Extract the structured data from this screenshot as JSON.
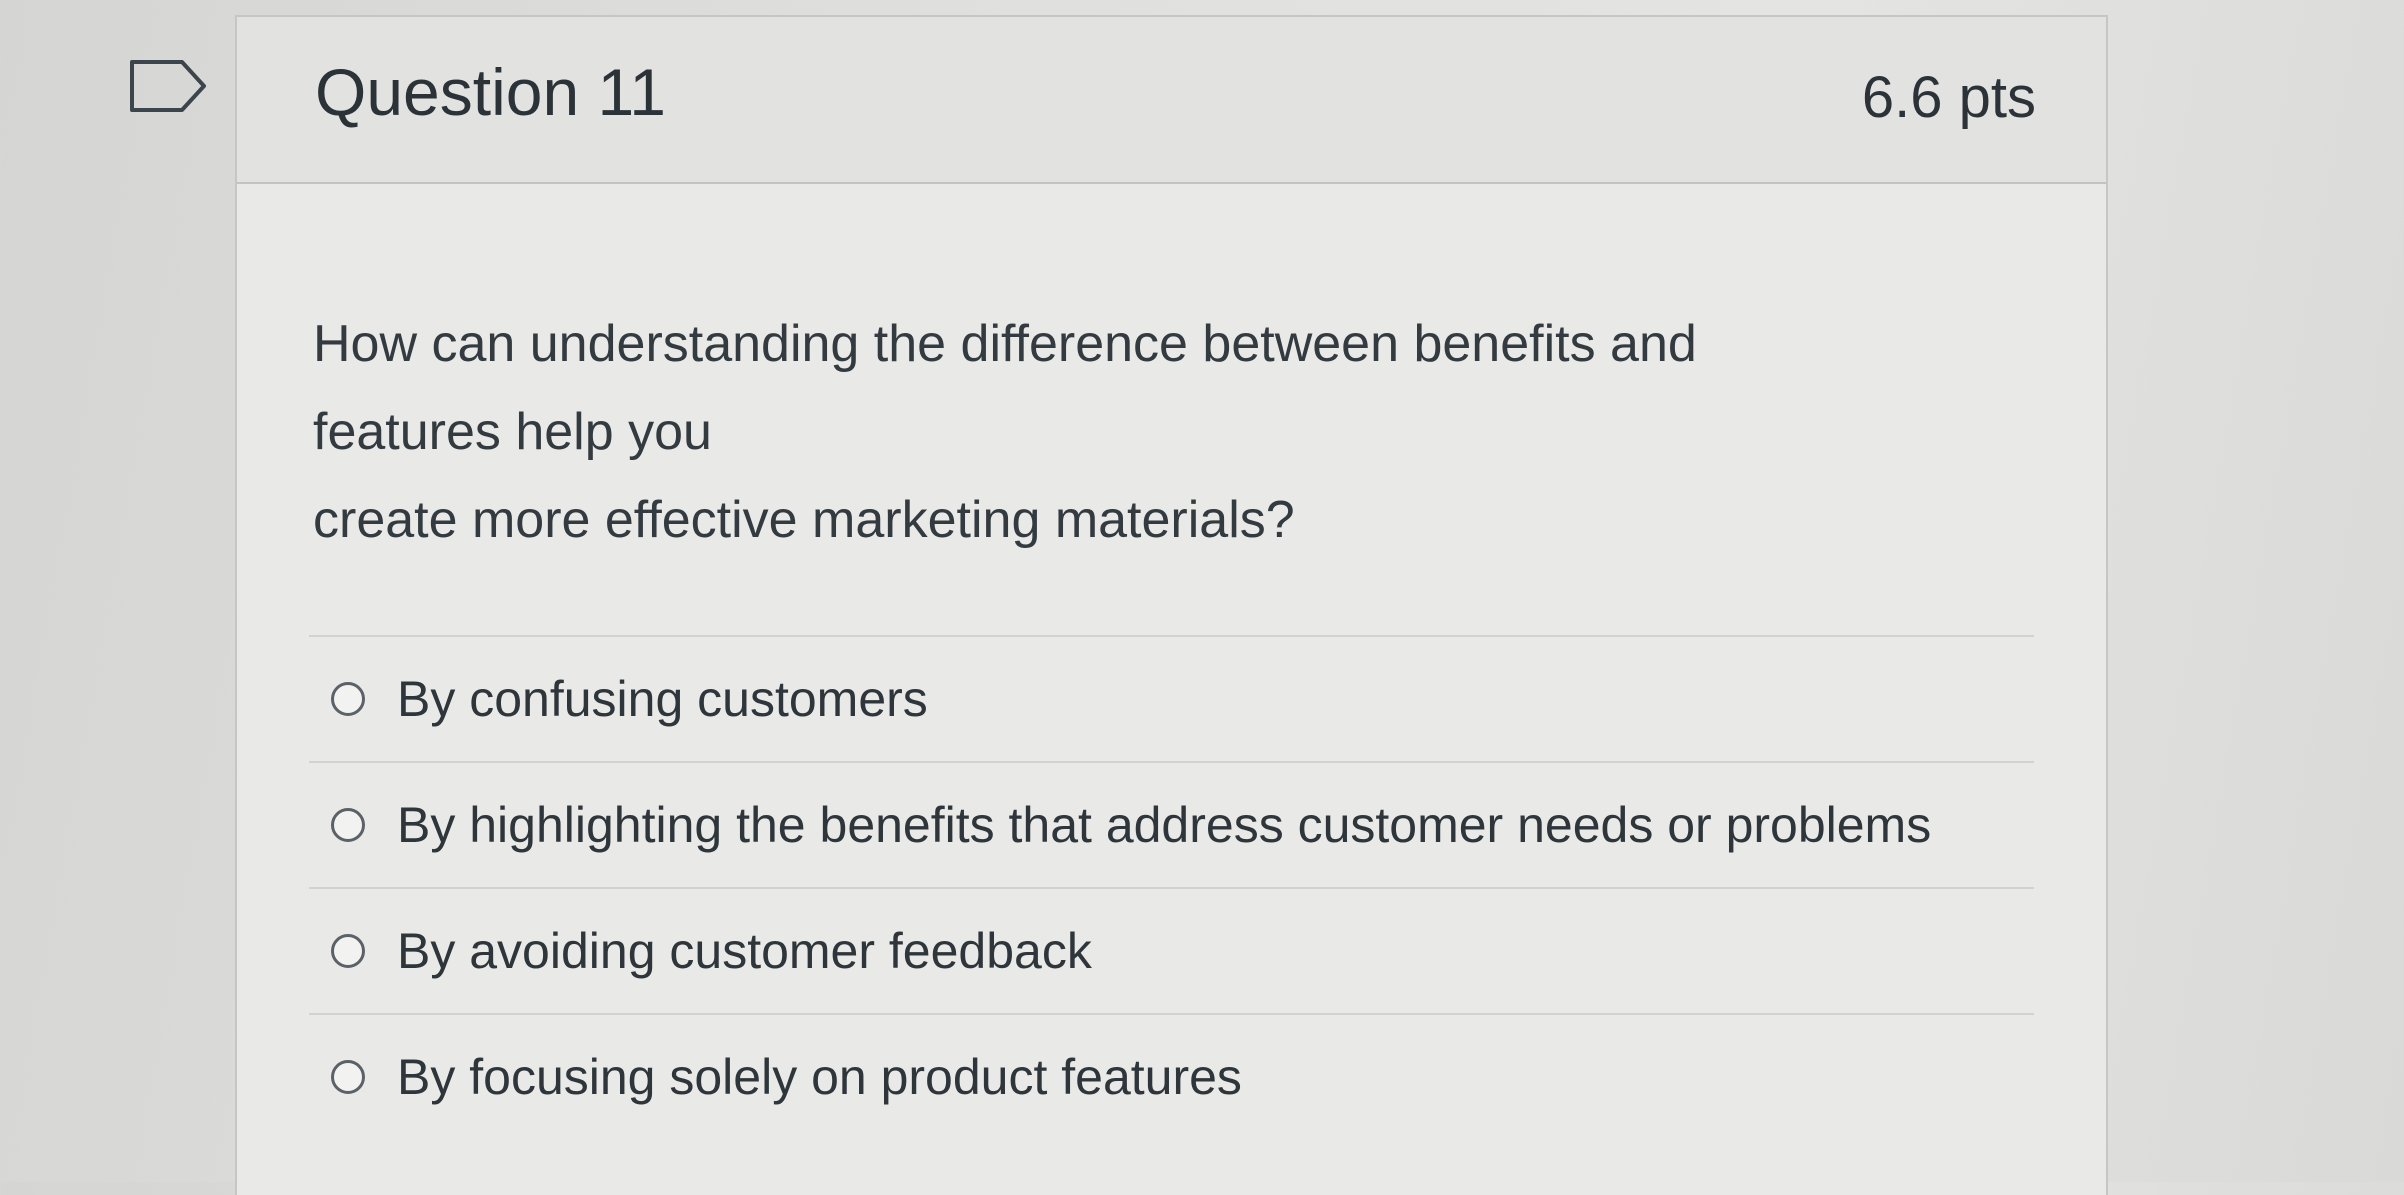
{
  "question": {
    "title": "Question 11",
    "points": "6.6 pts",
    "text_lines": [
      "How can understanding the difference between benefits and",
      "features help you",
      "create more effective marketing materials?"
    ],
    "answers": [
      {
        "label": "By confusing customers",
        "selected": false
      },
      {
        "label": "By highlighting the benefits that address customer needs or problems",
        "selected": false
      },
      {
        "label": "By avoiding customer feedback",
        "selected": false
      },
      {
        "label": "By focusing solely on product features",
        "selected": false
      }
    ]
  },
  "icons": {
    "flag": "flag-outline-icon"
  },
  "colors": {
    "text": "#2d3b45",
    "card_background": "#e9e9e7",
    "header_background": "#e2e2e0",
    "border": "#c6c6c4"
  }
}
